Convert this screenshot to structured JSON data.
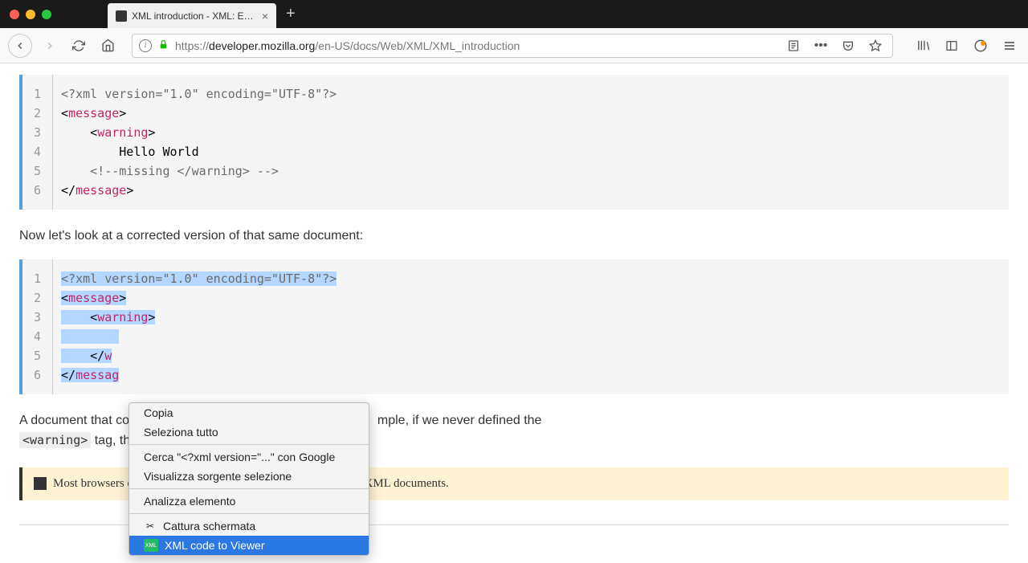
{
  "window": {
    "tab_title": "XML introduction - XML: Extens",
    "new_tab_tooltip": "+"
  },
  "toolbar": {
    "url_prefix": "https://",
    "url_domain": "developer.mozilla.org",
    "url_path": "/en-US/docs/Web/XML/XML_introduction"
  },
  "content": {
    "code1": {
      "lines": [
        "1",
        "2",
        "3",
        "4",
        "5",
        "6"
      ],
      "l1_pre": "<?xml version=\"1.0\" encoding=\"UTF-8\"?>",
      "l2_open": "<",
      "l2_tag": "message",
      "l2_close": ">",
      "l3_pad": "    ",
      "l3_open": "<",
      "l3_tag": "warning",
      "l3_close": ">",
      "l4": "        Hello World",
      "l5": "    <!--missing </warning> -->",
      "l6_open": "</",
      "l6_tag": "message",
      "l6_close": ">"
    },
    "para1": "Now let's look at a corrected version of that same document:",
    "code2": {
      "lines": [
        "1",
        "2",
        "3",
        "4",
        "5",
        "6"
      ],
      "l1_pre": "<?xml version=\"1.0\" encoding=\"UTF-8\"?>",
      "l2_open": "<",
      "l2_tag": "message",
      "l2_close": ">",
      "l3_pad": "    ",
      "l3_open": "<",
      "l3_tag": "warning",
      "l3_close": ">",
      "l4_pad": "        ",
      "l5_pad": "    ",
      "l5_open": "</",
      "l5_tag": "w",
      "l6_open": "</",
      "l6_tag": "messag"
    },
    "para2_a": "A document that co",
    "para2_b": "mple, if we never defined the ",
    "inline_code": "<warning>",
    "para2_c": " tag, th",
    "note": "Most browsers offer a debugger that can identify poorly-formed XML documents."
  },
  "context_menu": {
    "copy": "Copia",
    "select_all": "Seleziona tutto",
    "search_google": "Cerca \"<?xml version=\"...\" con Google",
    "view_source": "Visualizza sorgente selezione",
    "inspect": "Analizza elemento",
    "screenshot": "Cattura schermata",
    "xml_viewer": "XML code to Viewer"
  }
}
